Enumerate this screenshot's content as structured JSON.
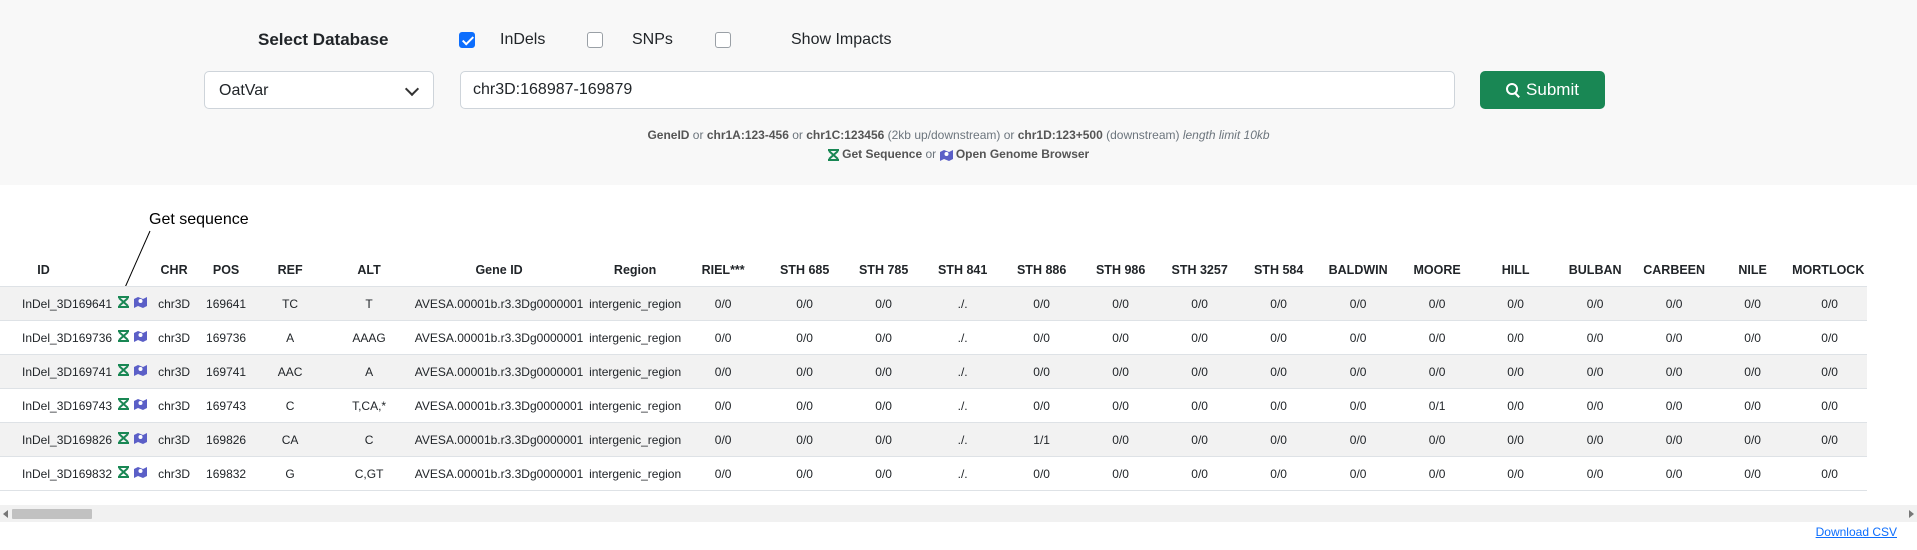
{
  "form": {
    "select_label": "Select Database",
    "options": [
      {
        "label": "InDels",
        "checked": true
      },
      {
        "label": "SNPs",
        "checked": false
      },
      {
        "label": "Show Impacts",
        "checked": false
      }
    ],
    "database_value": "OatVar",
    "region_value": "chr3D:168987-169879",
    "submit_label": "Submit"
  },
  "hint": {
    "gene_id": "GeneID",
    "or1": "or",
    "ex1": "chr1A:123-456",
    "or2": "or",
    "ex2": "chr1C:123456",
    "ex2_note": "(2kb up/downstream)",
    "or3": "or",
    "ex3": "chr1D:123+500",
    "ex3_note": "(downstream)",
    "limit": "length limit 10kb",
    "get_sequence": "Get Sequence",
    "or4": "or",
    "open_browser": "Open Genome Browser"
  },
  "annotation": {
    "text": "Get sequence"
  },
  "table": {
    "columns": [
      "ID",
      "CHR",
      "POS",
      "REF",
      "ALT",
      "Gene ID",
      "Region",
      "RIEL***",
      "STH 685",
      "STH 785",
      "STH 841",
      "STH 886",
      "STH 986",
      "STH 3257",
      "STH 584",
      "BALDWIN",
      "MOORE",
      "HILL",
      "BULBAN",
      "CARBEEN",
      "NILE",
      "MORTLOCK"
    ],
    "rows": [
      [
        "InDel_3D169641",
        "chr3D",
        "169641",
        "TC",
        "T",
        "AVESA.00001b.r3.3Dg0000001",
        "intergenic_region",
        "0/0",
        "0/0",
        "0/0",
        "./.",
        "0/0",
        "0/0",
        "0/0",
        "0/0",
        "0/0",
        "0/0",
        "0/0",
        "0/0",
        "0/0",
        "0/0",
        "0/0"
      ],
      [
        "InDel_3D169736",
        "chr3D",
        "169736",
        "A",
        "AAAG",
        "AVESA.00001b.r3.3Dg0000001",
        "intergenic_region",
        "0/0",
        "0/0",
        "0/0",
        "./.",
        "0/0",
        "0/0",
        "0/0",
        "0/0",
        "0/0",
        "0/0",
        "0/0",
        "0/0",
        "0/0",
        "0/0",
        "0/0"
      ],
      [
        "InDel_3D169741",
        "chr3D",
        "169741",
        "AAC",
        "A",
        "AVESA.00001b.r3.3Dg0000001",
        "intergenic_region",
        "0/0",
        "0/0",
        "0/0",
        "./.",
        "0/0",
        "0/0",
        "0/0",
        "0/0",
        "0/0",
        "0/0",
        "0/0",
        "0/0",
        "0/0",
        "0/0",
        "0/0"
      ],
      [
        "InDel_3D169743",
        "chr3D",
        "169743",
        "C",
        "T,CA,*",
        "AVESA.00001b.r3.3Dg0000001",
        "intergenic_region",
        "0/0",
        "0/0",
        "0/0",
        "./.",
        "0/0",
        "0/0",
        "0/0",
        "0/0",
        "0/0",
        "0/1",
        "0/0",
        "0/0",
        "0/0",
        "0/0",
        "0/0"
      ],
      [
        "InDel_3D169826",
        "chr3D",
        "169826",
        "CA",
        "C",
        "AVESA.00001b.r3.3Dg0000001",
        "intergenic_region",
        "0/0",
        "0/0",
        "0/0",
        "./.",
        "1/1",
        "0/0",
        "0/0",
        "0/0",
        "0/0",
        "0/0",
        "0/0",
        "0/0",
        "0/0",
        "0/0",
        "0/0"
      ],
      [
        "InDel_3D169832",
        "chr3D",
        "169832",
        "G",
        "C,GT",
        "AVESA.00001b.r3.3Dg0000001",
        "intergenic_region",
        "0/0",
        "0/0",
        "0/0",
        "./.",
        "0/0",
        "0/0",
        "0/0",
        "0/0",
        "0/0",
        "0/0",
        "0/0",
        "0/0",
        "0/0",
        "0/0",
        "0/0"
      ]
    ]
  },
  "download_label": "Download CSV",
  "colors": {
    "primary": "#0d6efd",
    "success": "#198754",
    "seq_icon": "#198754",
    "map_icon": "#5b5fc7",
    "annotation": "#e00000"
  },
  "icons": {
    "sequence": "dna-sequence-icon",
    "browser": "map-icon",
    "submit": "search-icon"
  }
}
